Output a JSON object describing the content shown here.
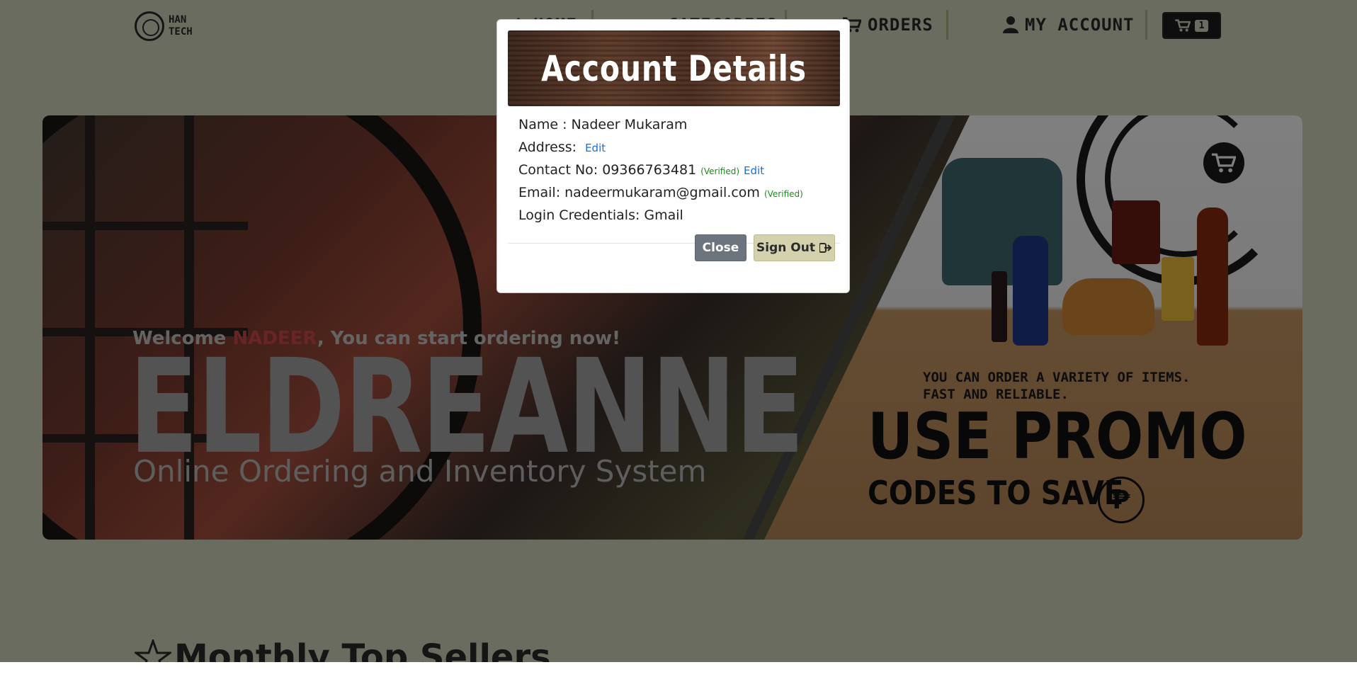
{
  "navbar": {
    "logo_line1": "HAN",
    "logo_line2": "TECH",
    "home_label": "HOME",
    "categories_label": "CATEGORIES",
    "orders_label": "ORDERS",
    "account_label": "MY ACCOUNT",
    "cart_count": "1"
  },
  "banner": {
    "welcome_prefix": "Welcome ",
    "welcome_name": "NADEER",
    "welcome_suffix": ", You can start ordering now!",
    "brand": "ELDREANNE",
    "subtitle": "Online Ordering and Inventory System",
    "promo_line1": "YOU CAN ORDER A VARIETY OF ITEMS.",
    "promo_line2": "FAST AND RELIABLE.",
    "promo_big": "USE PROMO",
    "promo_codes": "CODES TO SAVE",
    "peso_symbol": "₱"
  },
  "section": {
    "title": "Monthly Top Sellers"
  },
  "modal": {
    "title": "Account Details",
    "name_label": "Name :",
    "name_value": "Nadeer Mukaram",
    "address_label": "Address:",
    "address_edit": "Edit",
    "contact_label": "Contact No:",
    "contact_value": "09366763481",
    "contact_verified": "(Verified)",
    "contact_edit": "Edit",
    "email_label": "Email:",
    "email_value": "nadeermukaram@gmail.com",
    "email_verified": "(Verified)",
    "login_label": "Login Credentials:",
    "login_value": "Gmail",
    "close_label": "Close",
    "signout_label": "Sign Out"
  },
  "colors": {
    "page_bg": "#d6d8c0",
    "verified": "#1e8a1e",
    "link": "#1a6fd8",
    "close_btn": "#6c757d",
    "signout_btn": "#d4d1ad"
  }
}
